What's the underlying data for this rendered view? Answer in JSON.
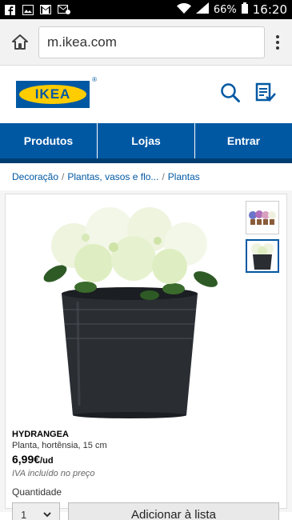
{
  "status_bar": {
    "battery": "66%",
    "time": "16:20"
  },
  "browser": {
    "url": "m.ikea.com"
  },
  "header": {
    "logo_text": "IKEA"
  },
  "nav": {
    "tabs": [
      "Produtos",
      "Lojas",
      "Entrar"
    ]
  },
  "breadcrumb": {
    "items": [
      "Decoração",
      "Plantas, vasos e flo...",
      "Plantas"
    ]
  },
  "product": {
    "name": "HYDRANGEA",
    "description": "Planta, hortênsia, 15 cm",
    "price": "6,99€",
    "unit": "/ud",
    "vat_note": "IVA incluído no preço",
    "quantity_label": "Quantidade",
    "quantity_value": "1",
    "add_label": "Adicionar à lista"
  },
  "colors": {
    "brand_blue": "#0058a3",
    "brand_yellow": "#ffcc00"
  }
}
